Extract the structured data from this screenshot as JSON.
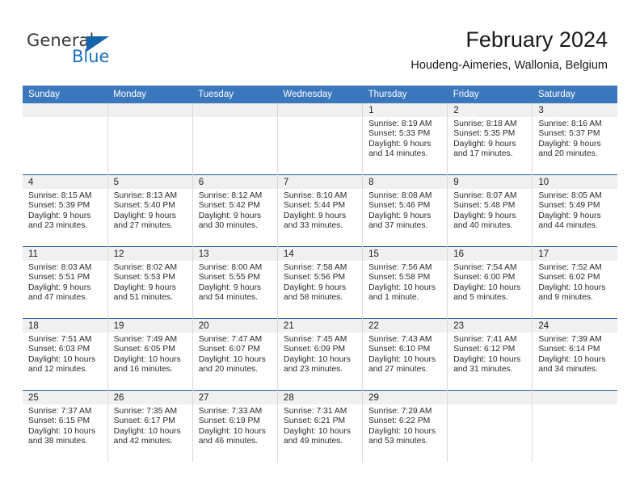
{
  "logo": {
    "word_general": "General",
    "word_blue": "Blue",
    "triangle_color": "#1565ab"
  },
  "header": {
    "title": "February 2024",
    "location": "Houdeng-Aimeries, Wallonia, Belgium"
  },
  "theme": {
    "header_row_bg": "#3b77bc",
    "row_divider": "#2a5f9e",
    "daynum_band_bg": "#f0f0f0",
    "cell_bg": "#ffffff",
    "text": "#1a1a1a"
  },
  "weekday_headers": [
    "Sunday",
    "Monday",
    "Tuesday",
    "Wednesday",
    "Thursday",
    "Friday",
    "Saturday"
  ],
  "weeks": [
    [
      {
        "day": "",
        "sunrise": "",
        "sunset": "",
        "daylight_line1": "",
        "daylight_line2": ""
      },
      {
        "day": "",
        "sunrise": "",
        "sunset": "",
        "daylight_line1": "",
        "daylight_line2": ""
      },
      {
        "day": "",
        "sunrise": "",
        "sunset": "",
        "daylight_line1": "",
        "daylight_line2": ""
      },
      {
        "day": "",
        "sunrise": "",
        "sunset": "",
        "daylight_line1": "",
        "daylight_line2": ""
      },
      {
        "day": "1",
        "sunrise": "Sunrise: 8:19 AM",
        "sunset": "Sunset: 5:33 PM",
        "daylight_line1": "Daylight: 9 hours",
        "daylight_line2": "and 14 minutes."
      },
      {
        "day": "2",
        "sunrise": "Sunrise: 8:18 AM",
        "sunset": "Sunset: 5:35 PM",
        "daylight_line1": "Daylight: 9 hours",
        "daylight_line2": "and 17 minutes."
      },
      {
        "day": "3",
        "sunrise": "Sunrise: 8:16 AM",
        "sunset": "Sunset: 5:37 PM",
        "daylight_line1": "Daylight: 9 hours",
        "daylight_line2": "and 20 minutes."
      }
    ],
    [
      {
        "day": "4",
        "sunrise": "Sunrise: 8:15 AM",
        "sunset": "Sunset: 5:39 PM",
        "daylight_line1": "Daylight: 9 hours",
        "daylight_line2": "and 23 minutes."
      },
      {
        "day": "5",
        "sunrise": "Sunrise: 8:13 AM",
        "sunset": "Sunset: 5:40 PM",
        "daylight_line1": "Daylight: 9 hours",
        "daylight_line2": "and 27 minutes."
      },
      {
        "day": "6",
        "sunrise": "Sunrise: 8:12 AM",
        "sunset": "Sunset: 5:42 PM",
        "daylight_line1": "Daylight: 9 hours",
        "daylight_line2": "and 30 minutes."
      },
      {
        "day": "7",
        "sunrise": "Sunrise: 8:10 AM",
        "sunset": "Sunset: 5:44 PM",
        "daylight_line1": "Daylight: 9 hours",
        "daylight_line2": "and 33 minutes."
      },
      {
        "day": "8",
        "sunrise": "Sunrise: 8:08 AM",
        "sunset": "Sunset: 5:46 PM",
        "daylight_line1": "Daylight: 9 hours",
        "daylight_line2": "and 37 minutes."
      },
      {
        "day": "9",
        "sunrise": "Sunrise: 8:07 AM",
        "sunset": "Sunset: 5:48 PM",
        "daylight_line1": "Daylight: 9 hours",
        "daylight_line2": "and 40 minutes."
      },
      {
        "day": "10",
        "sunrise": "Sunrise: 8:05 AM",
        "sunset": "Sunset: 5:49 PM",
        "daylight_line1": "Daylight: 9 hours",
        "daylight_line2": "and 44 minutes."
      }
    ],
    [
      {
        "day": "11",
        "sunrise": "Sunrise: 8:03 AM",
        "sunset": "Sunset: 5:51 PM",
        "daylight_line1": "Daylight: 9 hours",
        "daylight_line2": "and 47 minutes."
      },
      {
        "day": "12",
        "sunrise": "Sunrise: 8:02 AM",
        "sunset": "Sunset: 5:53 PM",
        "daylight_line1": "Daylight: 9 hours",
        "daylight_line2": "and 51 minutes."
      },
      {
        "day": "13",
        "sunrise": "Sunrise: 8:00 AM",
        "sunset": "Sunset: 5:55 PM",
        "daylight_line1": "Daylight: 9 hours",
        "daylight_line2": "and 54 minutes."
      },
      {
        "day": "14",
        "sunrise": "Sunrise: 7:58 AM",
        "sunset": "Sunset: 5:56 PM",
        "daylight_line1": "Daylight: 9 hours",
        "daylight_line2": "and 58 minutes."
      },
      {
        "day": "15",
        "sunrise": "Sunrise: 7:56 AM",
        "sunset": "Sunset: 5:58 PM",
        "daylight_line1": "Daylight: 10 hours",
        "daylight_line2": "and 1 minute."
      },
      {
        "day": "16",
        "sunrise": "Sunrise: 7:54 AM",
        "sunset": "Sunset: 6:00 PM",
        "daylight_line1": "Daylight: 10 hours",
        "daylight_line2": "and 5 minutes."
      },
      {
        "day": "17",
        "sunrise": "Sunrise: 7:52 AM",
        "sunset": "Sunset: 6:02 PM",
        "daylight_line1": "Daylight: 10 hours",
        "daylight_line2": "and 9 minutes."
      }
    ],
    [
      {
        "day": "18",
        "sunrise": "Sunrise: 7:51 AM",
        "sunset": "Sunset: 6:03 PM",
        "daylight_line1": "Daylight: 10 hours",
        "daylight_line2": "and 12 minutes."
      },
      {
        "day": "19",
        "sunrise": "Sunrise: 7:49 AM",
        "sunset": "Sunset: 6:05 PM",
        "daylight_line1": "Daylight: 10 hours",
        "daylight_line2": "and 16 minutes."
      },
      {
        "day": "20",
        "sunrise": "Sunrise: 7:47 AM",
        "sunset": "Sunset: 6:07 PM",
        "daylight_line1": "Daylight: 10 hours",
        "daylight_line2": "and 20 minutes."
      },
      {
        "day": "21",
        "sunrise": "Sunrise: 7:45 AM",
        "sunset": "Sunset: 6:09 PM",
        "daylight_line1": "Daylight: 10 hours",
        "daylight_line2": "and 23 minutes."
      },
      {
        "day": "22",
        "sunrise": "Sunrise: 7:43 AM",
        "sunset": "Sunset: 6:10 PM",
        "daylight_line1": "Daylight: 10 hours",
        "daylight_line2": "and 27 minutes."
      },
      {
        "day": "23",
        "sunrise": "Sunrise: 7:41 AM",
        "sunset": "Sunset: 6:12 PM",
        "daylight_line1": "Daylight: 10 hours",
        "daylight_line2": "and 31 minutes."
      },
      {
        "day": "24",
        "sunrise": "Sunrise: 7:39 AM",
        "sunset": "Sunset: 6:14 PM",
        "daylight_line1": "Daylight: 10 hours",
        "daylight_line2": "and 34 minutes."
      }
    ],
    [
      {
        "day": "25",
        "sunrise": "Sunrise: 7:37 AM",
        "sunset": "Sunset: 6:15 PM",
        "daylight_line1": "Daylight: 10 hours",
        "daylight_line2": "and 38 minutes."
      },
      {
        "day": "26",
        "sunrise": "Sunrise: 7:35 AM",
        "sunset": "Sunset: 6:17 PM",
        "daylight_line1": "Daylight: 10 hours",
        "daylight_line2": "and 42 minutes."
      },
      {
        "day": "27",
        "sunrise": "Sunrise: 7:33 AM",
        "sunset": "Sunset: 6:19 PM",
        "daylight_line1": "Daylight: 10 hours",
        "daylight_line2": "and 46 minutes."
      },
      {
        "day": "28",
        "sunrise": "Sunrise: 7:31 AM",
        "sunset": "Sunset: 6:21 PM",
        "daylight_line1": "Daylight: 10 hours",
        "daylight_line2": "and 49 minutes."
      },
      {
        "day": "29",
        "sunrise": "Sunrise: 7:29 AM",
        "sunset": "Sunset: 6:22 PM",
        "daylight_line1": "Daylight: 10 hours",
        "daylight_line2": "and 53 minutes."
      },
      {
        "day": "",
        "sunrise": "",
        "sunset": "",
        "daylight_line1": "",
        "daylight_line2": ""
      },
      {
        "day": "",
        "sunrise": "",
        "sunset": "",
        "daylight_line1": "",
        "daylight_line2": ""
      }
    ]
  ]
}
